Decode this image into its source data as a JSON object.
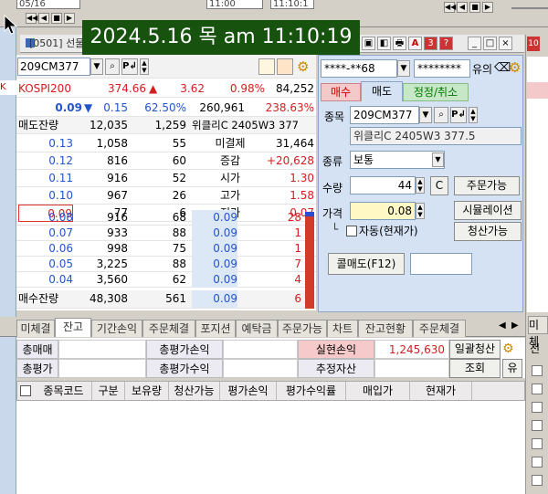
{
  "timestamp": "2024.5.16 목 am 11:10:19",
  "top_strip": {
    "date": "05/16",
    "time1": "11:00",
    "time2": "11:10:1",
    "media_buttons": [
      "◀◀",
      "◀",
      "■",
      "▶",
      "▶▶"
    ]
  },
  "window": {
    "screen_code": "[0501] 선물",
    "buttons": [
      "▣",
      "◧",
      "🖶",
      "A",
      "3",
      "?",
      "_",
      "□",
      "×"
    ]
  },
  "left_panel": {
    "code": "209CM377",
    "kospi_label": "KOSPI200",
    "kospi_value": "374.66",
    "kospi_arrow": "▲",
    "kospi_change": "3.62",
    "kospi_rate": "0.98%",
    "kospi_volume": "84,252",
    "price": "0.09",
    "price_arrow": "▼",
    "price_change": "0.15",
    "price_rate": "62.50%",
    "volume": "260,961",
    "vol_rate": "238.63%",
    "ask_total_label": "매도잔량",
    "ask_total": "12,035",
    "ask_total_cnt": "1,259",
    "name": "위클리C 2405W3 377",
    "asks": [
      {
        "price": "0.13",
        "qty": "1,058",
        "cnt": "55",
        "k": "미결제",
        "v": "31,464"
      },
      {
        "price": "0.12",
        "qty": "816",
        "cnt": "60",
        "k": "증감",
        "v": "+20,628"
      },
      {
        "price": "0.11",
        "qty": "916",
        "cnt": "52",
        "k": "시가",
        "v": "1.30"
      },
      {
        "price": "0.10",
        "qty": "967",
        "cnt": "26",
        "k": "고가",
        "v": "1.58"
      },
      {
        "price": "0.09",
        "qty": "77",
        "cnt": "6",
        "k": "저가",
        "v": "0.07"
      }
    ],
    "bids": [
      {
        "price": "0.08",
        "qty": "916",
        "cnt": "68",
        "tp": "0.09",
        "tq": "28"
      },
      {
        "price": "0.07",
        "qty": "933",
        "cnt": "88",
        "tp": "0.09",
        "tq": "1"
      },
      {
        "price": "0.06",
        "qty": "998",
        "cnt": "75",
        "tp": "0.09",
        "tq": "1"
      },
      {
        "price": "0.05",
        "qty": "3,225",
        "cnt": "88",
        "tp": "0.09",
        "tq": "7"
      },
      {
        "price": "0.04",
        "qty": "3,560",
        "cnt": "62",
        "tp": "0.09",
        "tq": "4"
      }
    ],
    "bid_total_label": "매수잔량",
    "bid_total": "48,308",
    "bid_total_cnt": "561",
    "bid_last_tp": "0.09",
    "bid_last_tq": "6"
  },
  "order_panel": {
    "acct1": "****-**68",
    "acct2": "********",
    "acct_label": "유의",
    "tabs": [
      "매수",
      "매도",
      "정정/취소"
    ],
    "item_label": "종목",
    "item_code": "209CM377",
    "item_name": "위클리C 2405W3 377.5",
    "type_label": "종류",
    "type_value": "보통",
    "qty_label": "수량",
    "qty_value": "44",
    "c_button": "C",
    "orderable_button": "주문가능",
    "price_label": "가격",
    "price_value": "0.08",
    "simulation_button": "시뮬레이션",
    "auto_label": "자동(현재가)",
    "liquidation_button": "청산가능",
    "sell_button": "콜매도(F12)"
  },
  "tabs": [
    "미체결",
    "잔고",
    "기간손익",
    "주문체결",
    "포지션",
    "예탁금",
    "주문가능",
    "차트",
    "잔고현황",
    "주문체결"
  ],
  "summary": {
    "r1": [
      "총매매",
      "",
      "총평가손익",
      "",
      "실현손익",
      "1,245,630",
      "일괄청산"
    ],
    "r2": [
      "총평가",
      "",
      "총평가수익",
      "",
      "추정자산",
      "",
      "조회",
      "유"
    ]
  },
  "grid_headers": [
    "종목코드",
    "구분",
    "보유량",
    "청산가능",
    "평가손익",
    "평가수익률",
    "매입가",
    "현재가"
  ],
  "right_edge": {
    "code_label": "10",
    "tab": "미체",
    "radio": "전"
  },
  "colors": {
    "up": "#d21e1e",
    "down": "#2255cc",
    "banner": "#17520f",
    "ask_bg": "#ffffff",
    "bid_bg": "#ffffff"
  }
}
